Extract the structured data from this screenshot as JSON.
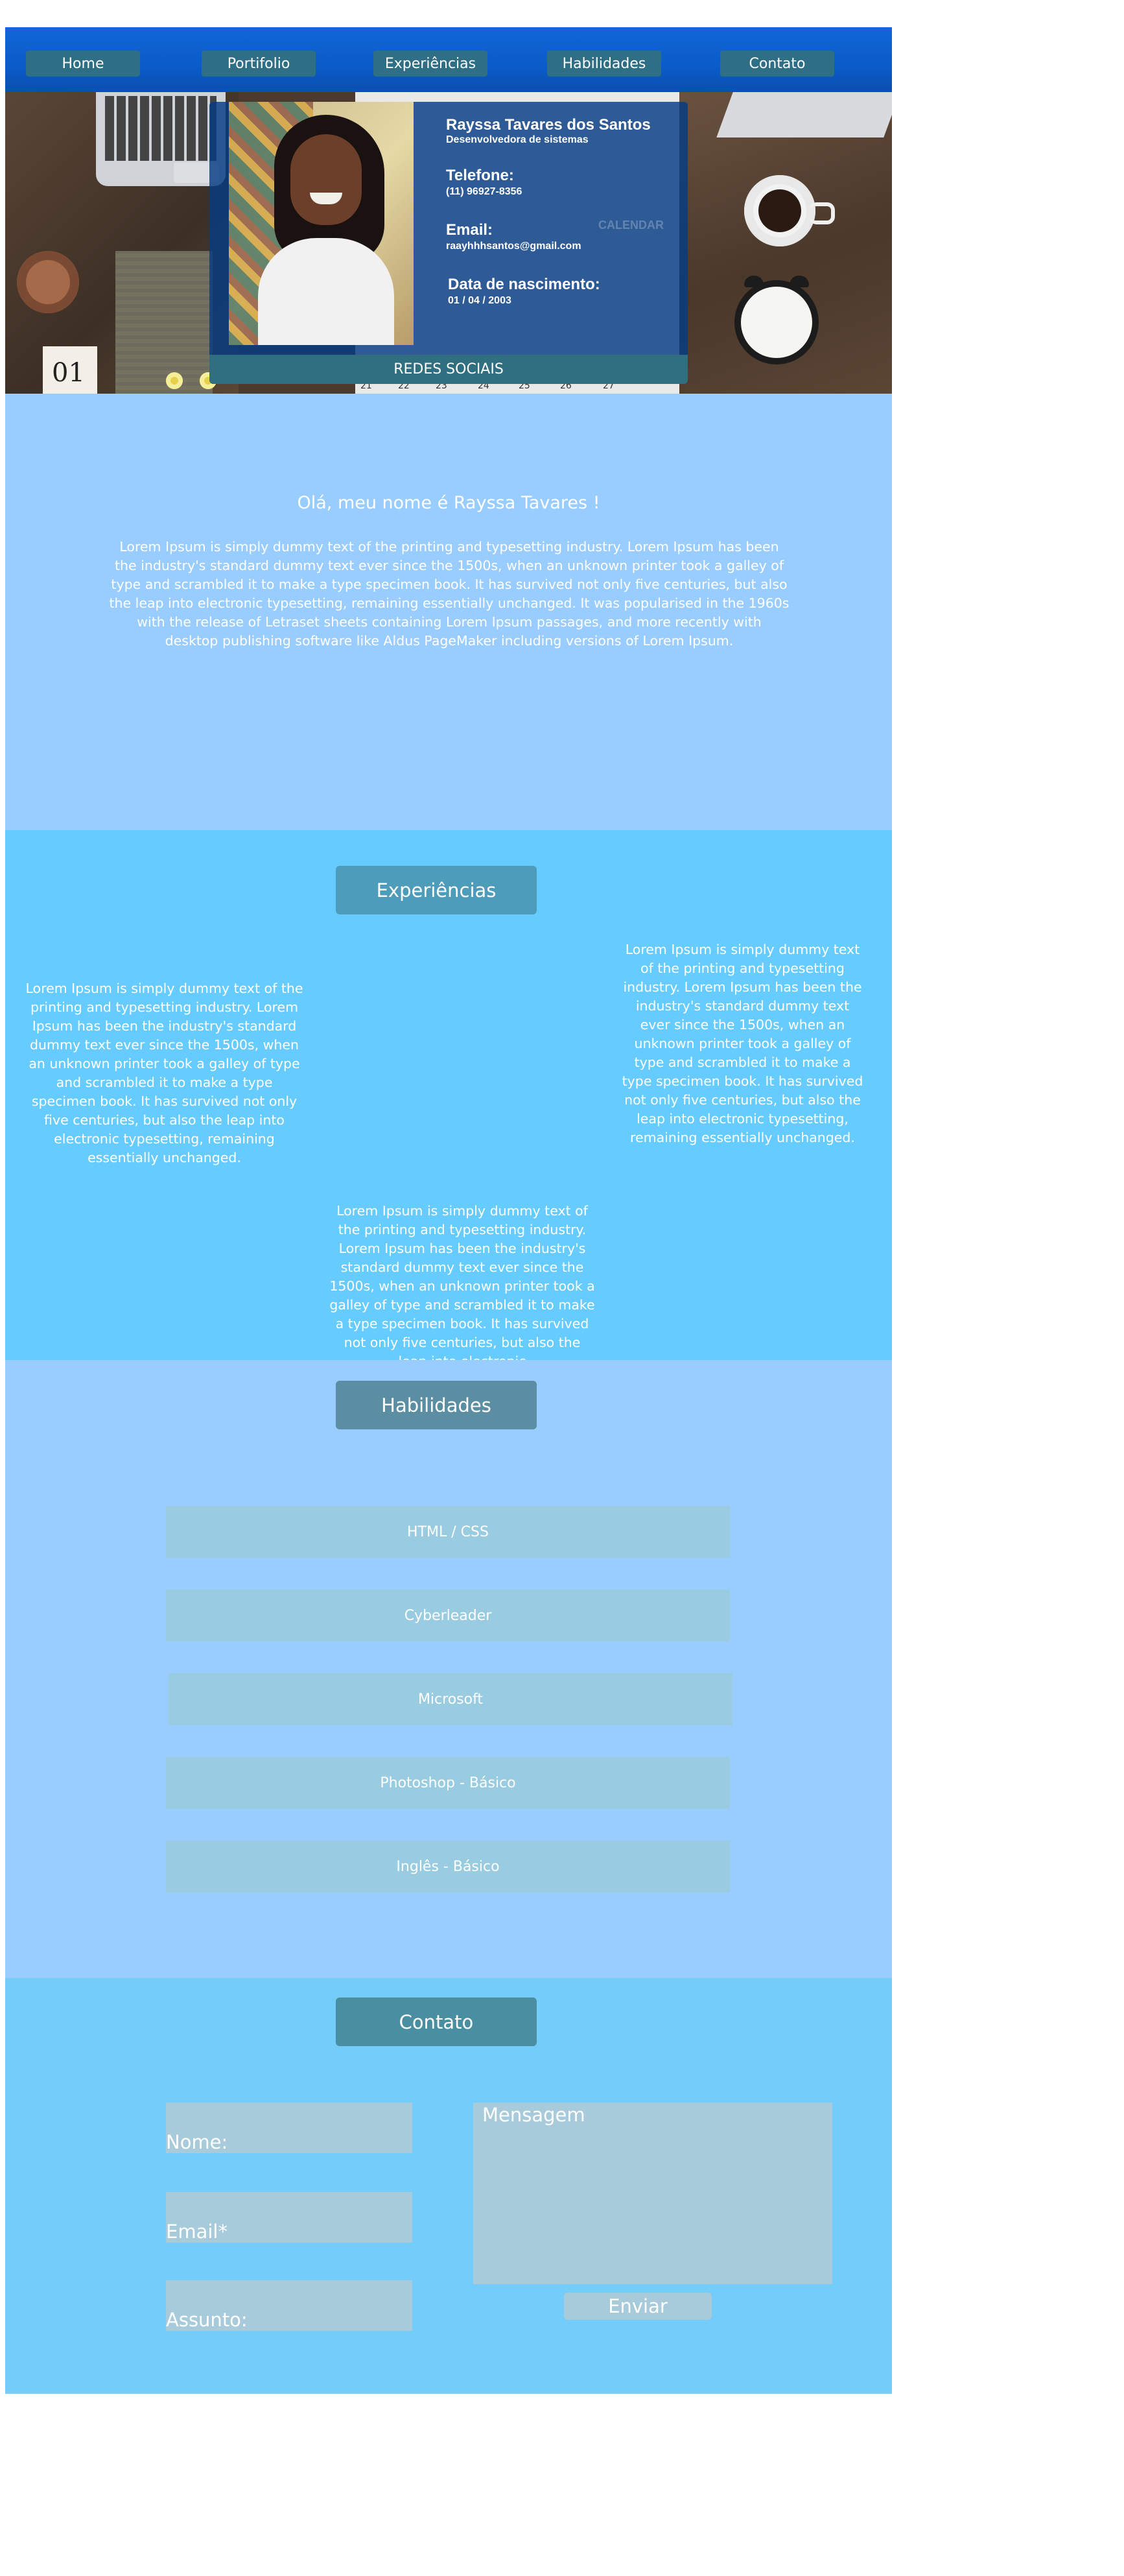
{
  "nav": {
    "items": [
      {
        "label": "Home"
      },
      {
        "label": "Portifolio"
      },
      {
        "label": "Experiências"
      },
      {
        "label": "Habilidades"
      },
      {
        "label": "Contato"
      }
    ]
  },
  "hero": {
    "name": "Rayssa Tavares dos Santos",
    "role": "Desenvolvedora de sistemas",
    "phone_label": "Telefone:",
    "phone": "(11) 96927-8356",
    "email_label": "Email:",
    "email": "raayhhhsantos@gmail.com",
    "birth_label": "Data de nascimento:",
    "birth": "01 / 04 / 2003",
    "social_label": "REDES SOCIAIS",
    "bg_paper_text": "01",
    "calendar_watermark": "CALENDAR",
    "calendar_numbers": [
      "21",
      "22",
      "23",
      "24",
      "25",
      "26",
      "27"
    ]
  },
  "about": {
    "title": "Olá, meu nome é Rayssa Tavares !",
    "text": "Lorem Ipsum is simply dummy text of the printing and typesetting industry. Lorem Ipsum has been the industry's standard dummy text ever since the 1500s, when an unknown printer took a galley of type and scrambled it to make a type specimen book. It has survived not only five centuries, but also the leap into electronic typesetting, remaining essentially unchanged. It was popularised in the 1960s with the release of Letraset sheets containing Lorem Ipsum passages, and more recently with desktop publishing software like Aldus PageMaker including versions of Lorem Ipsum."
  },
  "experiences": {
    "title": "Experiências",
    "left_text": "Lorem Ipsum is simply dummy text of the printing and typesetting industry. Lorem Ipsum has been the industry's standard dummy text ever since the 1500s, when an unknown printer took a galley of type and scrambled it to make a type specimen book. It has survived not only five centuries, but also the leap into electronic typesetting, remaining essentially unchanged.",
    "middle_text": "Lorem Ipsum is simply dummy text of the printing and typesetting industry. Lorem Ipsum has been the industry's standard dummy text ever since the 1500s, when an unknown printer took a galley of type and scrambled it to make a type specimen book. It has survived not only five centuries, but also the leap into electronic",
    "right_text": "Lorem Ipsum is simply dummy text of the printing and typesetting industry. Lorem Ipsum has been the industry's standard dummy text ever since the 1500s, when an unknown printer took a galley of type and scrambled it to make a type specimen book. It has survived not only five centuries, but also the leap into electronic typesetting, remaining essentially unchanged."
  },
  "skills": {
    "title": "Habilidades",
    "items": [
      {
        "label": "HTML / CSS"
      },
      {
        "label": "Cyberleader"
      },
      {
        "label": "Microsoft"
      },
      {
        "label": "Photoshop - Básico"
      },
      {
        "label": "Inglês - Básico"
      }
    ]
  },
  "contact": {
    "title": "Contato",
    "name_label": "Nome:",
    "email_label": "Email*",
    "subject_label": "Assunto:",
    "message_label": "Mensagem",
    "send_label": "Enviar"
  },
  "colors": {
    "nav": "#0a5cc9",
    "about_bg": "#99ccff",
    "experiences_bg": "#66ccff",
    "skills_bg": "#99ccff",
    "contact_bg": "#74ccf8"
  }
}
